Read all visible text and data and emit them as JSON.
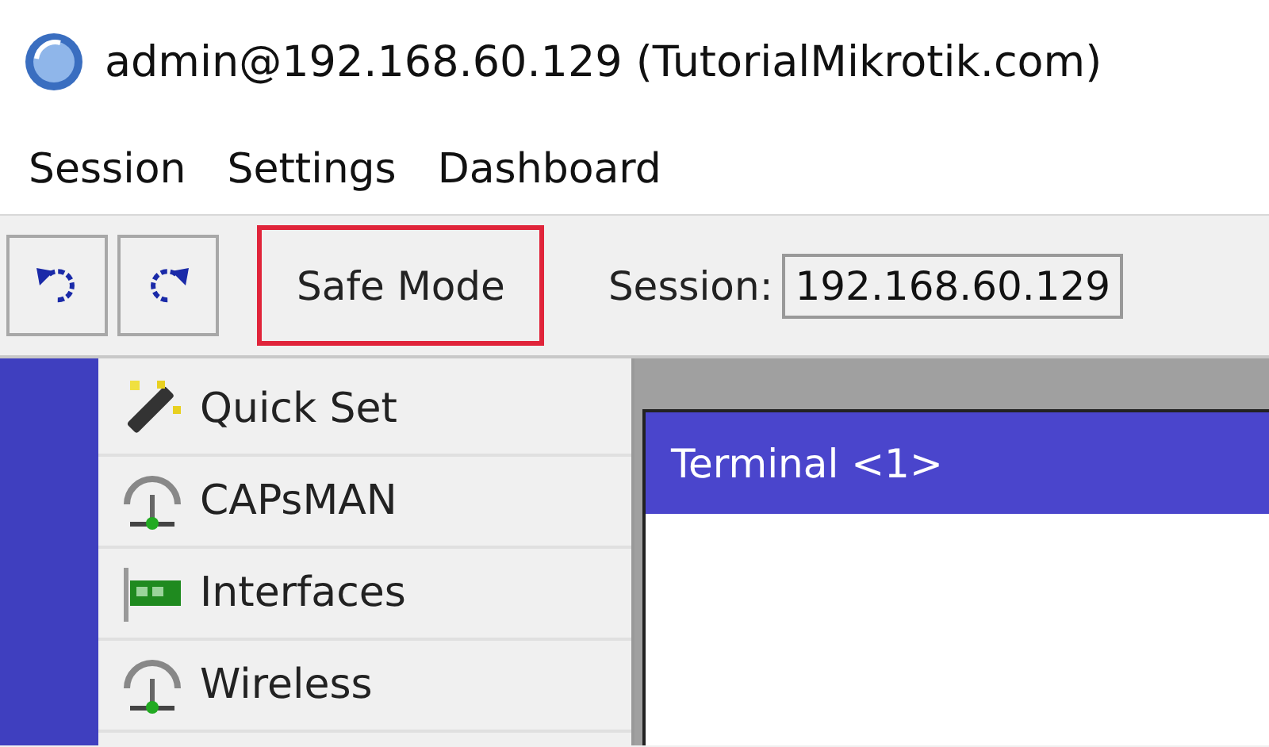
{
  "window": {
    "title": "admin@192.168.60.129 (TutorialMikrotik.com)"
  },
  "menu": [
    "Session",
    "Settings",
    "Dashboard"
  ],
  "toolbar": {
    "safe_mode": "Safe Mode",
    "session_label": "Session:",
    "session_value": "192.168.60.129"
  },
  "sidebar": {
    "items": [
      {
        "label": "Quick Set",
        "kind": "wand"
      },
      {
        "label": "CAPsMAN",
        "kind": "antenna"
      },
      {
        "label": "Interfaces",
        "kind": "card"
      },
      {
        "label": "Wireless",
        "kind": "antenna"
      }
    ]
  },
  "terminal": {
    "title": "Terminal <1>"
  }
}
